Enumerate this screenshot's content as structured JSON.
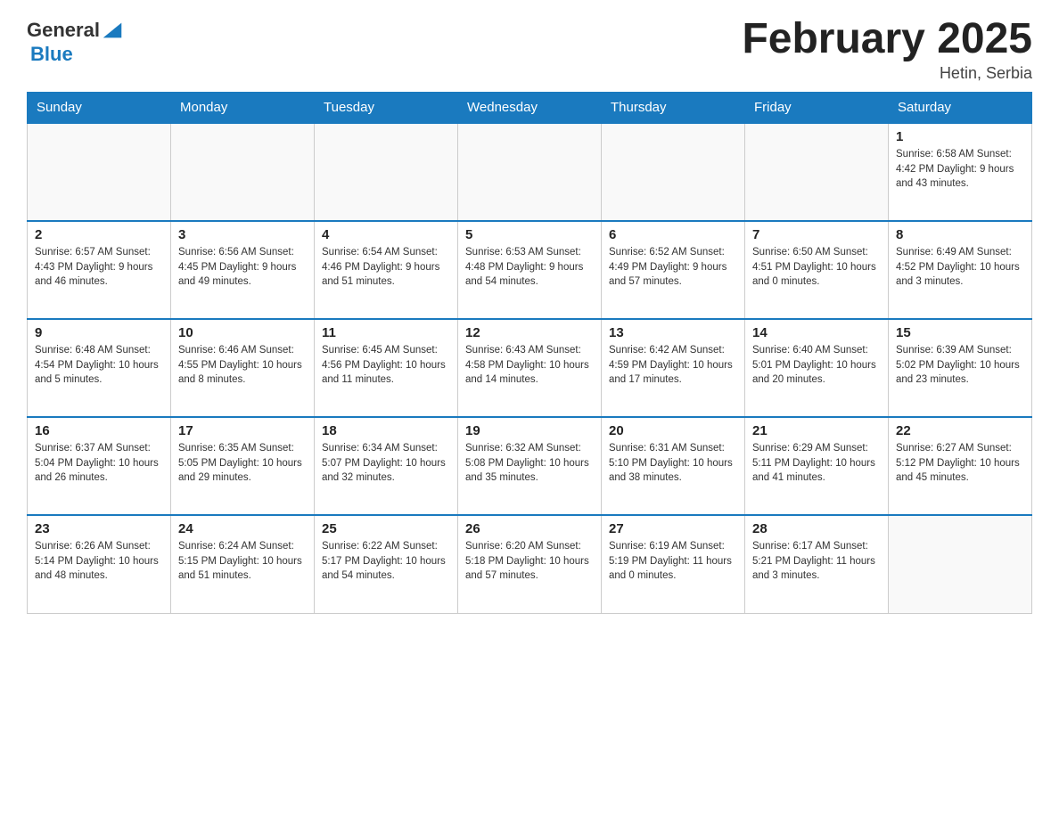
{
  "header": {
    "logo_general": "General",
    "logo_blue": "Blue",
    "month_title": "February 2025",
    "location": "Hetin, Serbia"
  },
  "days_of_week": [
    "Sunday",
    "Monday",
    "Tuesday",
    "Wednesday",
    "Thursday",
    "Friday",
    "Saturday"
  ],
  "weeks": [
    [
      {
        "day": "",
        "info": ""
      },
      {
        "day": "",
        "info": ""
      },
      {
        "day": "",
        "info": ""
      },
      {
        "day": "",
        "info": ""
      },
      {
        "day": "",
        "info": ""
      },
      {
        "day": "",
        "info": ""
      },
      {
        "day": "1",
        "info": "Sunrise: 6:58 AM\nSunset: 4:42 PM\nDaylight: 9 hours\nand 43 minutes."
      }
    ],
    [
      {
        "day": "2",
        "info": "Sunrise: 6:57 AM\nSunset: 4:43 PM\nDaylight: 9 hours\nand 46 minutes."
      },
      {
        "day": "3",
        "info": "Sunrise: 6:56 AM\nSunset: 4:45 PM\nDaylight: 9 hours\nand 49 minutes."
      },
      {
        "day": "4",
        "info": "Sunrise: 6:54 AM\nSunset: 4:46 PM\nDaylight: 9 hours\nand 51 minutes."
      },
      {
        "day": "5",
        "info": "Sunrise: 6:53 AM\nSunset: 4:48 PM\nDaylight: 9 hours\nand 54 minutes."
      },
      {
        "day": "6",
        "info": "Sunrise: 6:52 AM\nSunset: 4:49 PM\nDaylight: 9 hours\nand 57 minutes."
      },
      {
        "day": "7",
        "info": "Sunrise: 6:50 AM\nSunset: 4:51 PM\nDaylight: 10 hours\nand 0 minutes."
      },
      {
        "day": "8",
        "info": "Sunrise: 6:49 AM\nSunset: 4:52 PM\nDaylight: 10 hours\nand 3 minutes."
      }
    ],
    [
      {
        "day": "9",
        "info": "Sunrise: 6:48 AM\nSunset: 4:54 PM\nDaylight: 10 hours\nand 5 minutes."
      },
      {
        "day": "10",
        "info": "Sunrise: 6:46 AM\nSunset: 4:55 PM\nDaylight: 10 hours\nand 8 minutes."
      },
      {
        "day": "11",
        "info": "Sunrise: 6:45 AM\nSunset: 4:56 PM\nDaylight: 10 hours\nand 11 minutes."
      },
      {
        "day": "12",
        "info": "Sunrise: 6:43 AM\nSunset: 4:58 PM\nDaylight: 10 hours\nand 14 minutes."
      },
      {
        "day": "13",
        "info": "Sunrise: 6:42 AM\nSunset: 4:59 PM\nDaylight: 10 hours\nand 17 minutes."
      },
      {
        "day": "14",
        "info": "Sunrise: 6:40 AM\nSunset: 5:01 PM\nDaylight: 10 hours\nand 20 minutes."
      },
      {
        "day": "15",
        "info": "Sunrise: 6:39 AM\nSunset: 5:02 PM\nDaylight: 10 hours\nand 23 minutes."
      }
    ],
    [
      {
        "day": "16",
        "info": "Sunrise: 6:37 AM\nSunset: 5:04 PM\nDaylight: 10 hours\nand 26 minutes."
      },
      {
        "day": "17",
        "info": "Sunrise: 6:35 AM\nSunset: 5:05 PM\nDaylight: 10 hours\nand 29 minutes."
      },
      {
        "day": "18",
        "info": "Sunrise: 6:34 AM\nSunset: 5:07 PM\nDaylight: 10 hours\nand 32 minutes."
      },
      {
        "day": "19",
        "info": "Sunrise: 6:32 AM\nSunset: 5:08 PM\nDaylight: 10 hours\nand 35 minutes."
      },
      {
        "day": "20",
        "info": "Sunrise: 6:31 AM\nSunset: 5:10 PM\nDaylight: 10 hours\nand 38 minutes."
      },
      {
        "day": "21",
        "info": "Sunrise: 6:29 AM\nSunset: 5:11 PM\nDaylight: 10 hours\nand 41 minutes."
      },
      {
        "day": "22",
        "info": "Sunrise: 6:27 AM\nSunset: 5:12 PM\nDaylight: 10 hours\nand 45 minutes."
      }
    ],
    [
      {
        "day": "23",
        "info": "Sunrise: 6:26 AM\nSunset: 5:14 PM\nDaylight: 10 hours\nand 48 minutes."
      },
      {
        "day": "24",
        "info": "Sunrise: 6:24 AM\nSunset: 5:15 PM\nDaylight: 10 hours\nand 51 minutes."
      },
      {
        "day": "25",
        "info": "Sunrise: 6:22 AM\nSunset: 5:17 PM\nDaylight: 10 hours\nand 54 minutes."
      },
      {
        "day": "26",
        "info": "Sunrise: 6:20 AM\nSunset: 5:18 PM\nDaylight: 10 hours\nand 57 minutes."
      },
      {
        "day": "27",
        "info": "Sunrise: 6:19 AM\nSunset: 5:19 PM\nDaylight: 11 hours\nand 0 minutes."
      },
      {
        "day": "28",
        "info": "Sunrise: 6:17 AM\nSunset: 5:21 PM\nDaylight: 11 hours\nand 3 minutes."
      },
      {
        "day": "",
        "info": ""
      }
    ]
  ]
}
